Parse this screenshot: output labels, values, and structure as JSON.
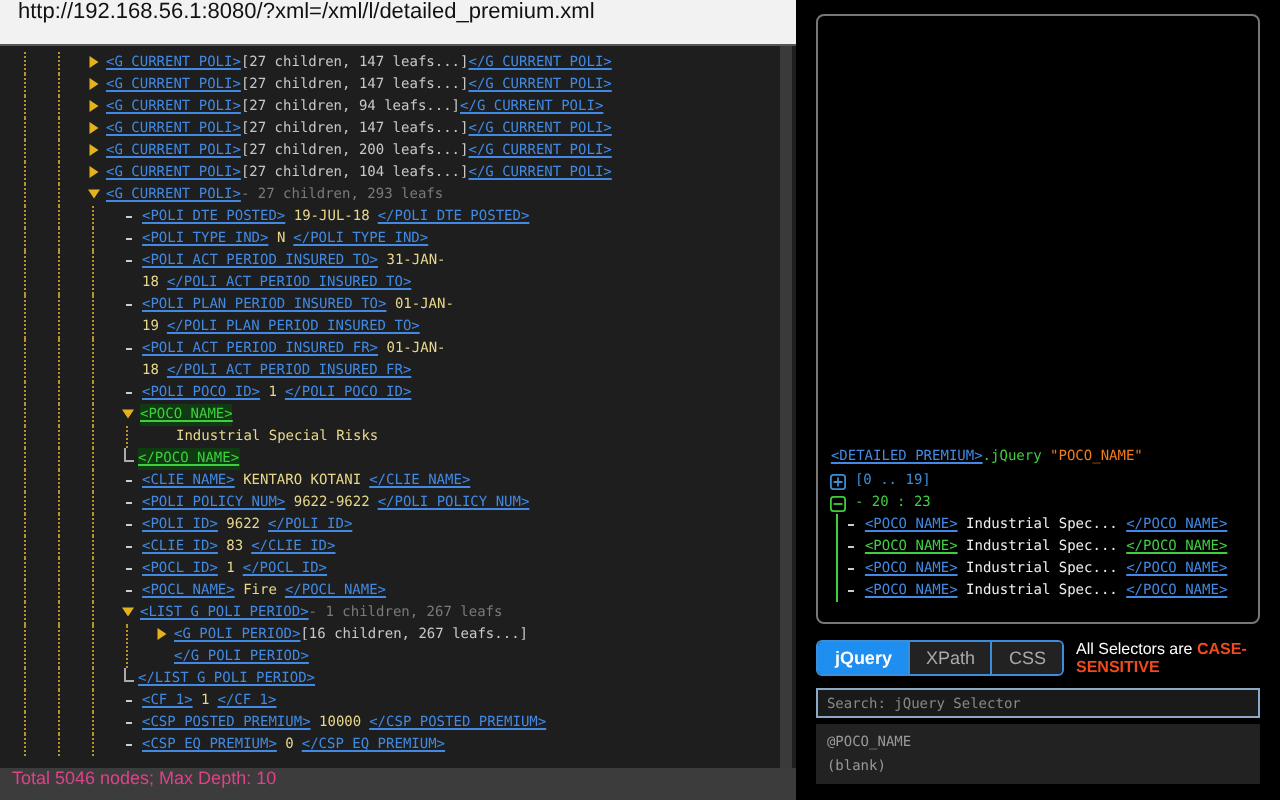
{
  "address_bar": {
    "url": "http://192.168.56.1:8080/?xml=/xml/l/detailed_premium.xml"
  },
  "tree": {
    "nodes": [
      {
        "kind": "element",
        "open_tag": "<G_CURRENT_POLI>",
        "summary": "[27 children, 147 leafs...]",
        "close_tag": "</G_CURRENT_POLI>",
        "expanded": false,
        "selected": false
      },
      {
        "kind": "element",
        "open_tag": "<G_CURRENT_POLI>",
        "summary": "[27 children, 147 leafs...]",
        "close_tag": "</G_CURRENT_POLI>",
        "expanded": false,
        "selected": false
      },
      {
        "kind": "element",
        "open_tag": "<G_CURRENT_POLI>",
        "summary": "[27 children, 94 leafs...]",
        "close_tag": "</G_CURRENT_POLI>",
        "expanded": false,
        "selected": false
      },
      {
        "kind": "element",
        "open_tag": "<G_CURRENT_POLI>",
        "summary": "[27 children, 147 leafs...]",
        "close_tag": "</G_CURRENT_POLI>",
        "expanded": false,
        "selected": false
      },
      {
        "kind": "element",
        "open_tag": "<G_CURRENT_POLI>",
        "summary": "[27 children, 200 leafs...]",
        "close_tag": "</G_CURRENT_POLI>",
        "expanded": false,
        "selected": false
      },
      {
        "kind": "element",
        "open_tag": "<G_CURRENT_POLI>",
        "summary": "[27 children, 104 leafs...]",
        "close_tag": "</G_CURRENT_POLI>",
        "expanded": false,
        "selected": false
      },
      {
        "kind": "element",
        "open_tag": "<G_CURRENT_POLI>",
        "summary": "- 27 children, 293 leafs",
        "expanded": true,
        "selected": false,
        "children": [
          {
            "kind": "leaf",
            "open_tag": "<POLI_DTE_POSTED>",
            "value": "19-JUL-18",
            "close_tag": "</POLI_DTE_POSTED>"
          },
          {
            "kind": "leaf",
            "open_tag": "<POLI_TYPE_IND>",
            "value": "N",
            "close_tag": "</POLI_TYPE_IND>"
          },
          {
            "kind": "leaf",
            "open_tag": "<POLI_ACT_PERIOD_INSURED_TO>",
            "value": "31-JAN-18",
            "close_tag": "</POLI_ACT_PERIOD_INSURED_TO>"
          },
          {
            "kind": "leaf",
            "open_tag": "<POLI_PLAN_PERIOD_INSURED_TO>",
            "value": "01-JAN-19",
            "close_tag": "</POLI_PLAN_PERIOD_INSURED_TO>"
          },
          {
            "kind": "leaf",
            "open_tag": "<POLI_ACT_PERIOD_INSURED_FR>",
            "value": "01-JAN-18",
            "close_tag": "</POLI_ACT_PERIOD_INSURED_FR>"
          },
          {
            "kind": "leaf",
            "open_tag": "<POLI_POCO_ID>",
            "value": "1",
            "close_tag": "</POLI_POCO_ID>"
          },
          {
            "kind": "element",
            "open_tag": "<POCO_NAME>",
            "expanded": true,
            "selected": true,
            "end_tag": "</POCO_NAME>",
            "children": [
              {
                "kind": "text",
                "value": "Industrial Special Risks"
              }
            ]
          },
          {
            "kind": "leaf",
            "open_tag": "<CLIE_NAME>",
            "value": "KENTARO KOTANI",
            "close_tag": "</CLIE_NAME>"
          },
          {
            "kind": "leaf",
            "open_tag": "<POLI_POLICY_NUM>",
            "value": "9622-9622",
            "close_tag": "</POLI_POLICY_NUM>"
          },
          {
            "kind": "leaf",
            "open_tag": "<POLI_ID>",
            "value": "9622",
            "close_tag": "</POLI_ID>"
          },
          {
            "kind": "leaf",
            "open_tag": "<CLIE_ID>",
            "value": "83",
            "close_tag": "</CLIE_ID>"
          },
          {
            "kind": "leaf",
            "open_tag": "<POCL_ID>",
            "value": "1",
            "close_tag": "</POCL_ID>"
          },
          {
            "kind": "leaf",
            "open_tag": "<POCL_NAME>",
            "value": "Fire",
            "close_tag": "</POCL_NAME>"
          },
          {
            "kind": "element",
            "open_tag": "<LIST_G_POLI_PERIOD>",
            "summary": "- 1 children, 267 leafs",
            "expanded": true,
            "selected": false,
            "end_tag": "</LIST_G_POLI_PERIOD>",
            "children": [
              {
                "kind": "element",
                "open_tag": "<G_POLI_PERIOD>",
                "summary": "[16 children, 267 leafs...]",
                "close_tag": "</G_POLI_PERIOD>",
                "expanded": false,
                "selected": false
              }
            ]
          },
          {
            "kind": "leaf",
            "open_tag": "<CF_1>",
            "value": "1",
            "close_tag": "</CF_1>"
          },
          {
            "kind": "leaf",
            "open_tag": "<CSP_POSTED_PREMIUM>",
            "value": "10000",
            "close_tag": "</CSP_POSTED_PREMIUM>"
          },
          {
            "kind": "leaf",
            "open_tag": "<CSP_EQ_PREMIUM>",
            "value": "0",
            "close_tag": "</CSP_EQ_PREMIUM>"
          }
        ]
      }
    ]
  },
  "status_bar": {
    "text": "Total 5046 nodes; Max Depth: 10"
  },
  "results": {
    "context_tag": "<DETAILED_PREMIUM>",
    "method": ".jQuery",
    "argument": "\"POCO_NAME\"",
    "groups": [
      {
        "label": "[0 .. 19]",
        "expanded": false
      },
      {
        "label": "- 20 : 23",
        "expanded": true,
        "rows": [
          {
            "open_tag": "<POCO_NAME>",
            "text": "Industrial Spec...",
            "close_tag": "</POCO_NAME>",
            "selected": false
          },
          {
            "open_tag": "<POCO_NAME>",
            "text": "Industrial Spec...",
            "close_tag": "</POCO_NAME>",
            "selected": true
          },
          {
            "open_tag": "<POCO_NAME>",
            "text": "Industrial Spec...",
            "close_tag": "</POCO_NAME>",
            "selected": false
          },
          {
            "open_tag": "<POCO_NAME>",
            "text": "Industrial Spec...",
            "close_tag": "</POCO_NAME>",
            "selected": false
          }
        ]
      }
    ]
  },
  "tabs": [
    {
      "label": "jQuery",
      "selected": true
    },
    {
      "label": "XPath",
      "selected": false
    },
    {
      "label": "CSS",
      "selected": false
    }
  ],
  "notice": {
    "text": "All Selectors are",
    "emphasis": "CASE-SENSITIVE"
  },
  "search": {
    "placeholder": "Search: jQuery Selector"
  },
  "selection_info": [
    "@POCO_NAME",
    "(blank)"
  ]
}
